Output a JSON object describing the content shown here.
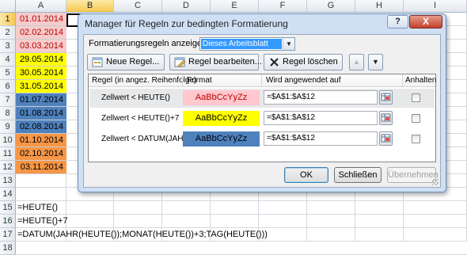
{
  "sheet": {
    "columns": [
      "A",
      "B",
      "C",
      "D",
      "E",
      "F",
      "G",
      "H",
      "I"
    ],
    "rows": [
      "1",
      "2",
      "3",
      "4",
      "5",
      "6",
      "7",
      "8",
      "9",
      "10",
      "11",
      "12",
      "13",
      "14",
      "15",
      "16",
      "17",
      "18"
    ],
    "cells": [
      {
        "text": "01.01.2014",
        "bg": "#f4cccc",
        "fg": "#c00000"
      },
      {
        "text": "02.02.2014",
        "bg": "#f4cccc",
        "fg": "#c00000"
      },
      {
        "text": "03.03.2014",
        "bg": "#f4cccc",
        "fg": "#c00000"
      },
      {
        "text": "29.05.2014",
        "bg": "#ffff00",
        "fg": "#000000"
      },
      {
        "text": "30.05.2014",
        "bg": "#ffff00",
        "fg": "#000000"
      },
      {
        "text": "31.05.2014",
        "bg": "#ffff00",
        "fg": "#000000"
      },
      {
        "text": "01.07.2014",
        "bg": "#4f81bd",
        "fg": "#000000"
      },
      {
        "text": "01.08.2014",
        "bg": "#4f81bd",
        "fg": "#000000"
      },
      {
        "text": "02.08.2014",
        "bg": "#4f81bd",
        "fg": "#000000"
      },
      {
        "text": "01.10.2014",
        "bg": "#f79646",
        "fg": "#000000"
      },
      {
        "text": "02.10.2014",
        "bg": "#f79646",
        "fg": "#000000"
      },
      {
        "text": "03.11.2014",
        "bg": "#f79646",
        "fg": "#000000"
      }
    ],
    "formulas": [
      {
        "row": 15,
        "text": "=HEUTE()"
      },
      {
        "row": 16,
        "text": "=HEUTE()+7"
      },
      {
        "row": 17,
        "text": "=DATUM(JAHR(HEUTE());MONAT(HEUTE())+3;TAG(HEUTE()))"
      }
    ]
  },
  "dialog": {
    "title": "Manager für Regeln zur bedingten Formatierung",
    "help_label": "?",
    "close_label": "X",
    "show_rules_label": "Formatierungsregeln anzeigen für:",
    "show_rules_value": "Dieses Arbeitsblatt",
    "buttons": {
      "new_rule": "Neue Regel...",
      "edit_rule": "Regel bearbeiten...",
      "delete_rule": "Regel löschen"
    },
    "columns": {
      "rule": "Regel (in angez. Reihenfolge)",
      "format": "Format",
      "applies_to": "Wird angewendet auf",
      "stop": "Anhalten"
    },
    "rules": [
      {
        "name": "Zellwert < HEUTE()",
        "preview": "AaBbCcYyZz",
        "preview_bg": "#ffc7ce",
        "preview_fg": "#c00000",
        "range": "=$A$1:$A$12"
      },
      {
        "name": "Zellwert < HEUTE()+7",
        "preview": "AaBbCcYyZz",
        "preview_bg": "#ffff00",
        "preview_fg": "#000000",
        "range": "=$A$1:$A$12"
      },
      {
        "name": "Zellwert < DATUM(JAH...",
        "preview": "AaBbCcYyZz",
        "preview_bg": "#4f81bd",
        "preview_fg": "#000000",
        "range": "=$A$1:$A$12"
      }
    ],
    "ok_label": "OK",
    "close_button_label": "Schließen",
    "apply_label": "Übernehmen"
  }
}
